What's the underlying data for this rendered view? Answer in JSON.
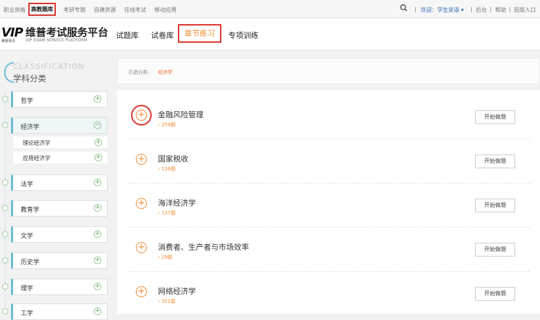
{
  "topbar": {
    "links": [
      "职业资格",
      "高教题库",
      "考研专题",
      "自建资源",
      "在线考试",
      "移动应用"
    ],
    "welcome": "欢迎：学生吴语 ▾",
    "right_links": [
      "后台",
      "帮助",
      "旧版入口"
    ],
    "sep": "|"
  },
  "header": {
    "logo_mark": "VIP",
    "logo_title": "维普考试服务平台",
    "logo_sub": "VIP EXAM SERVICE PLATFORM",
    "logo_small": "维普资讯",
    "nav": [
      "试题库",
      "试卷库",
      "章节练习",
      "专项训练"
    ]
  },
  "sidebar": {
    "title_en": "CLASSIFICATION",
    "title_cn": "学科分类",
    "categories": [
      {
        "label": "哲学",
        "toggle": "+"
      },
      {
        "label": "经济学",
        "toggle": "−"
      },
      {
        "label": "法学",
        "toggle": "+"
      },
      {
        "label": "教育学",
        "toggle": "+"
      },
      {
        "label": "文学",
        "toggle": "+"
      },
      {
        "label": "历史学",
        "toggle": "+"
      },
      {
        "label": "理学",
        "toggle": "+"
      },
      {
        "label": "工学",
        "toggle": "+"
      }
    ],
    "subcategories": [
      {
        "label": "理论经济学",
        "toggle": "+"
      },
      {
        "label": "应用经济学",
        "toggle": "+"
      }
    ]
  },
  "breadcrumb": {
    "label": "已选分类:",
    "value": "经济学"
  },
  "items": [
    {
      "title": "金融风险管理",
      "count": "› 259题",
      "button": "开始做题"
    },
    {
      "title": "国家税收",
      "count": "› 126题",
      "button": "开始做题"
    },
    {
      "title": "海洋经济学",
      "count": "› 137题",
      "button": "开始做题"
    },
    {
      "title": "消费者、生产者与市场效率",
      "count": "› 29题",
      "button": "开始做题"
    },
    {
      "title": "网络经济学",
      "count": "› 351题",
      "button": "开始做题"
    }
  ],
  "colors": {
    "accent": "#ef8a2e",
    "highlight_box": "#d9332e",
    "sidebar_accent": "#6bbcd4"
  },
  "icons": {
    "search": "search-icon",
    "expand": "plus-circle-icon"
  }
}
